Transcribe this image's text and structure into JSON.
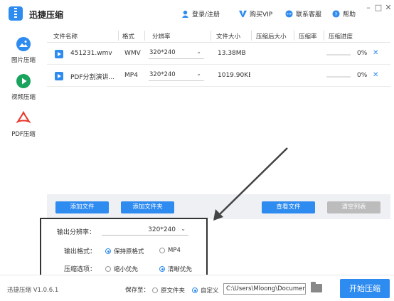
{
  "app": {
    "name": "迅捷压缩",
    "version": "迅捷压缩 V1.0.6.1"
  },
  "topbar": {
    "login": "登录/注册",
    "buy_vip": "购买VIP",
    "support": "联系客服",
    "help": "帮助",
    "window_controls": {
      "minimize": "–",
      "maximize": "□",
      "close": "✕"
    }
  },
  "sidebar": {
    "items": [
      {
        "label": "图片压缩",
        "icon": "image-icon"
      },
      {
        "label": "视频压缩",
        "icon": "video-play-icon"
      },
      {
        "label": "PDF压缩",
        "icon": "pdf-icon"
      }
    ]
  },
  "table": {
    "headers": [
      "文件名称",
      "格式",
      "分辨率",
      "文件大小",
      "压缩后大小",
      "压缩率",
      "压缩进度"
    ],
    "rows": [
      {
        "name": "451231.wmv",
        "format": "WMV",
        "resolution": "320*240",
        "size": "13.38MB",
        "progress": "0%",
        "progress_fraction": 0
      },
      {
        "name": "PDF分割演讲...",
        "format": "MP4",
        "resolution": "320*240",
        "size": "1019.90KE",
        "progress": "0%",
        "progress_fraction": 0
      }
    ]
  },
  "actions": {
    "add_file": "添加文件",
    "add_folder": "添加文件夹",
    "view_file": "查看文件",
    "clear_list": "清空列表"
  },
  "settings": {
    "output_res_label": "输出分辨率：",
    "output_res_value": "320*240",
    "output_format_label": "输出格式：",
    "format_options": [
      "保持原格式",
      "MP4"
    ],
    "format_selected": 0,
    "compress_label": "压缩选项：",
    "compress_options": [
      "缩小优先",
      "清晰优先"
    ],
    "compress_selected": 1
  },
  "footer": {
    "save_to": "保存至：",
    "save_options": [
      "原文件夹",
      "自定义"
    ],
    "save_selected": 1,
    "path": "C:\\Users\\Mloong\\Documen",
    "start": "开始压缩"
  },
  "colors": {
    "accent": "#2e8bf0",
    "highlight_border": "#333333",
    "gray_button": "#bcbcbc"
  }
}
